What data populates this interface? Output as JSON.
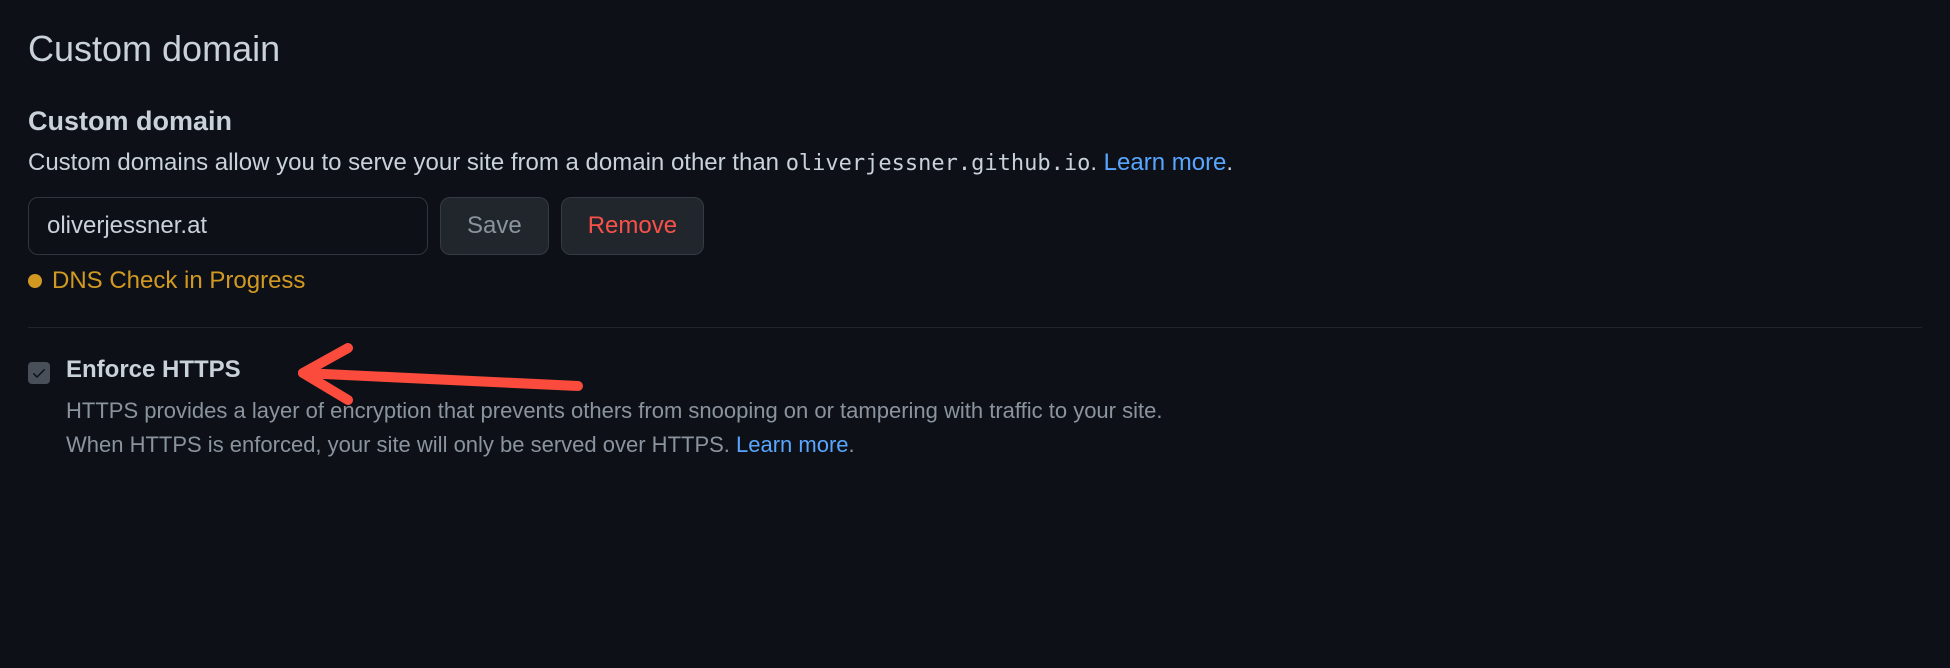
{
  "section": {
    "title": "Custom domain",
    "sub_title": "Custom domain",
    "description_prefix": "Custom domains allow you to serve your site from a domain other than ",
    "default_domain": "oliverjessner.github.io",
    "description_suffix": ". ",
    "learn_more": "Learn more",
    "description_end": "."
  },
  "form": {
    "domain_value": "oliverjessner.at",
    "save_label": "Save",
    "remove_label": "Remove"
  },
  "status": {
    "text": "DNS Check in Progress"
  },
  "https": {
    "title": "Enforce HTTPS",
    "line1": "HTTPS provides a layer of encryption that prevents others from snooping on or tampering with traffic to your site.",
    "line2_prefix": "When HTTPS is enforced, your site will only be served over HTTPS. ",
    "learn_more": "Learn more",
    "line2_suffix": "."
  }
}
